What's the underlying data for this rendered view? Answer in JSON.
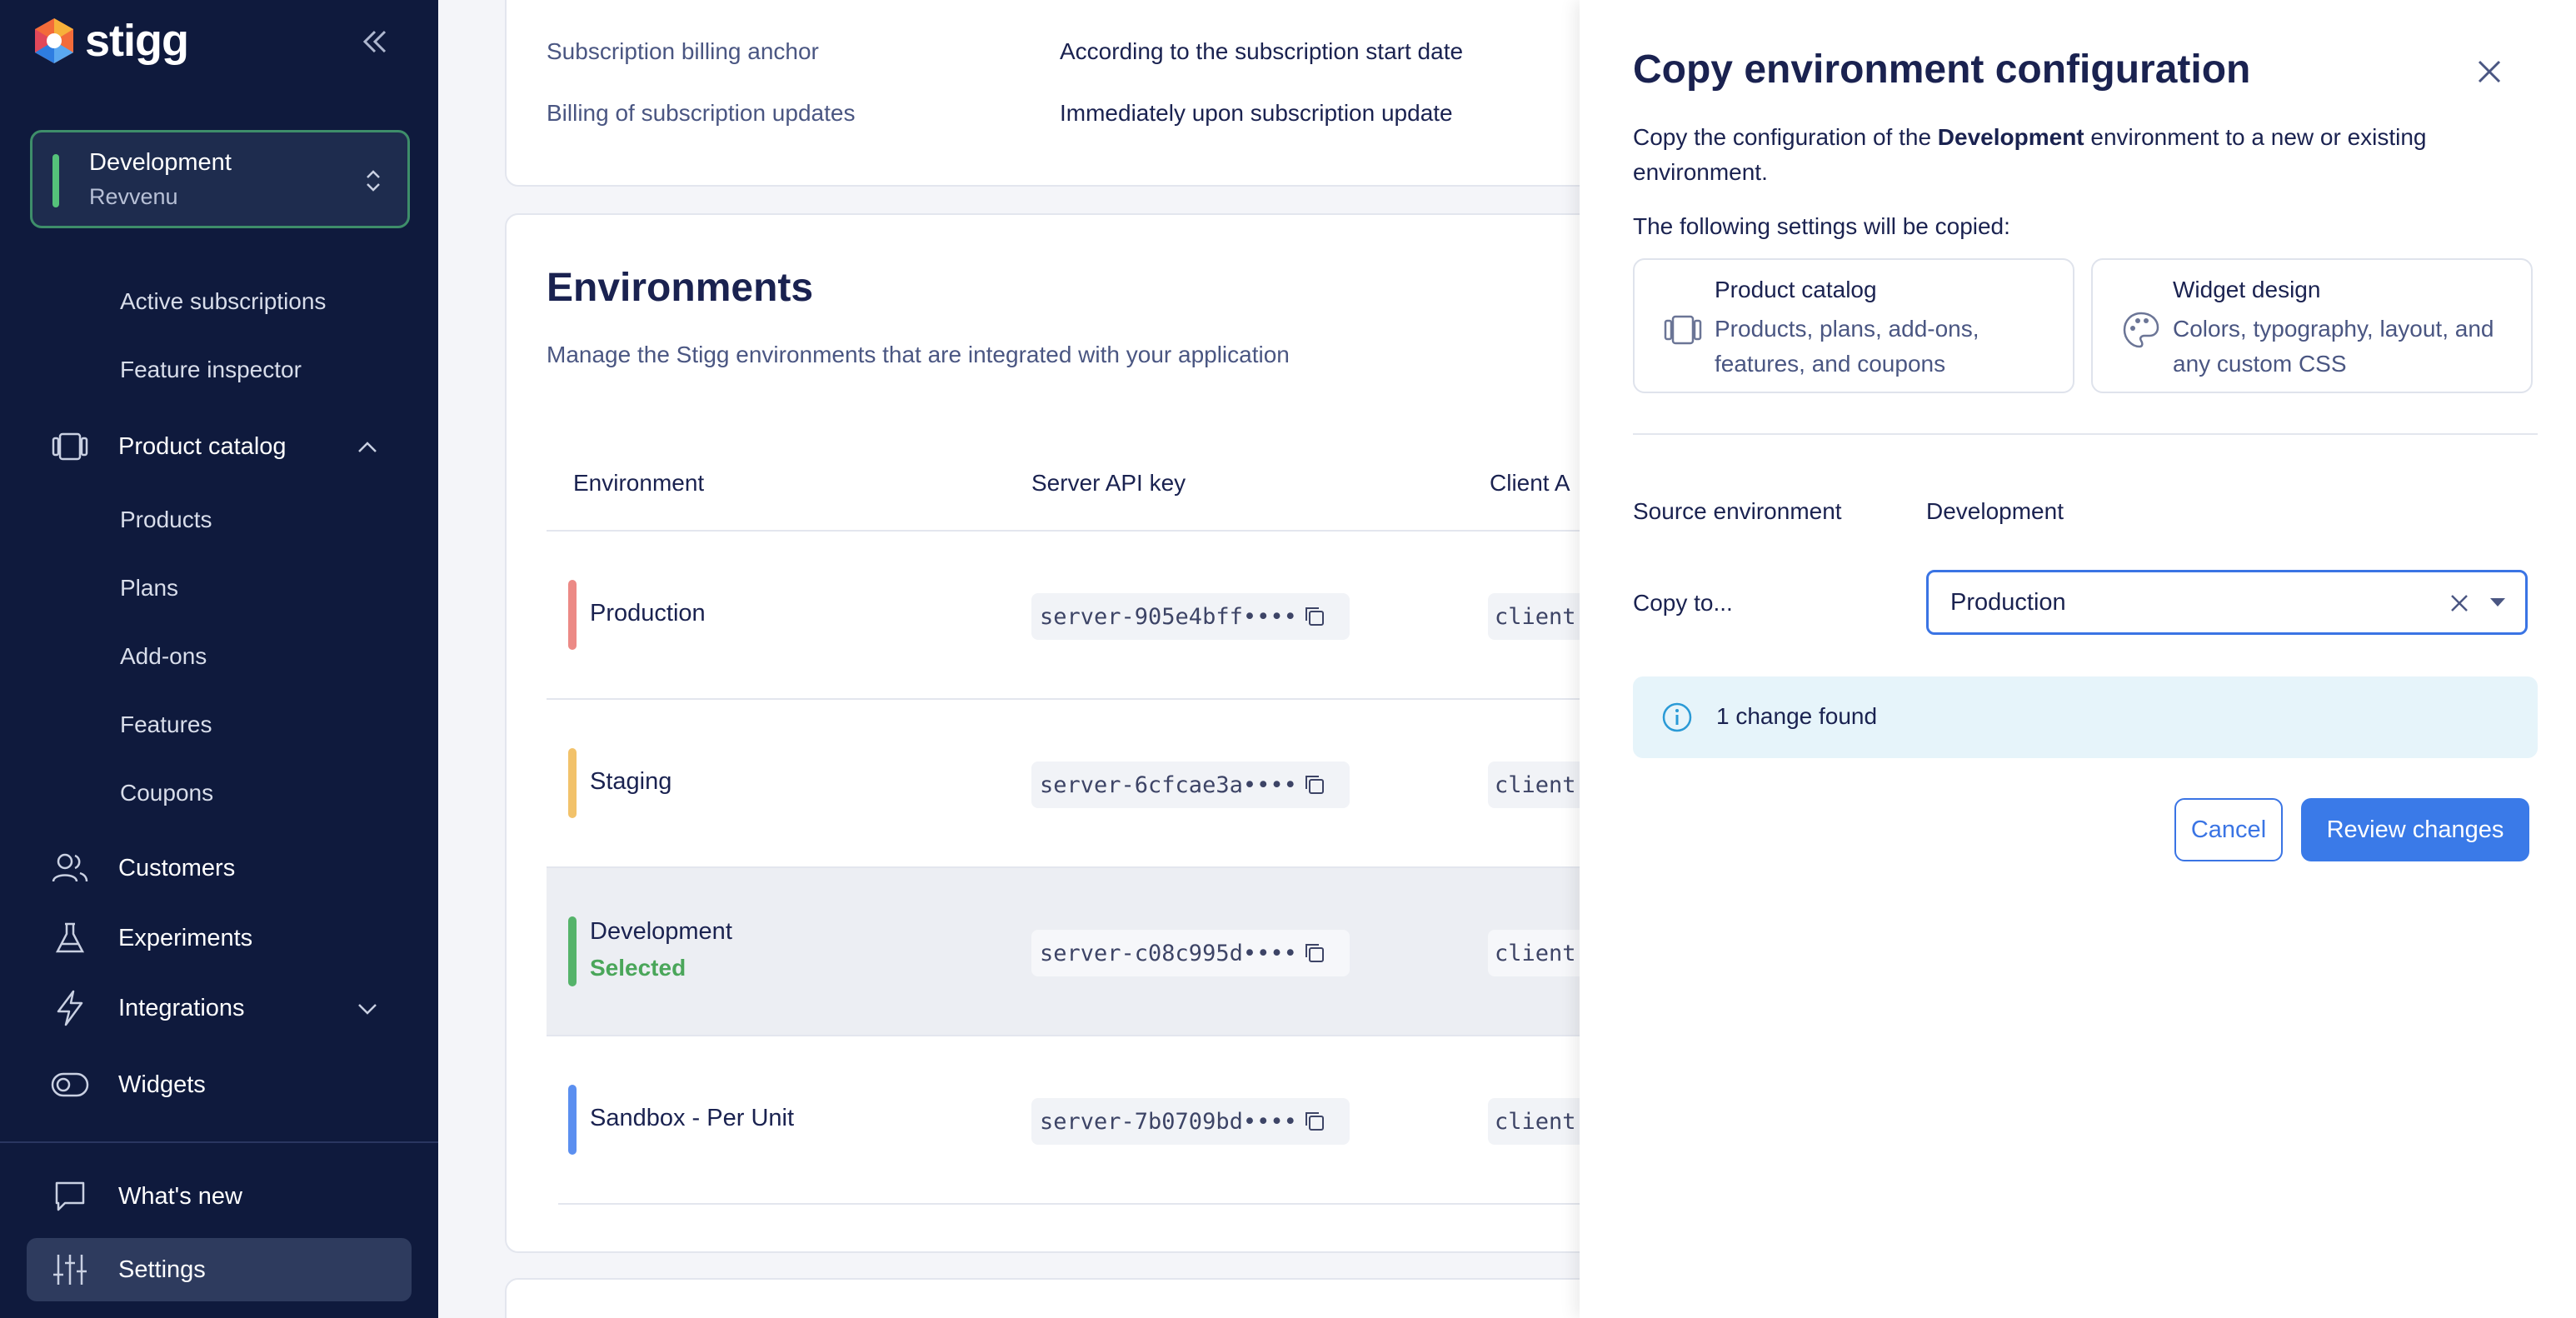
{
  "app": {
    "logo_text": "stigg"
  },
  "sidebar": {
    "environment": {
      "name": "Development",
      "sub": "Revvenu",
      "color": "#55c27a"
    },
    "sub_items_top": [
      {
        "label": "Active subscriptions"
      },
      {
        "label": "Feature inspector"
      }
    ],
    "product_catalog": {
      "label": "Product catalog",
      "items": [
        {
          "label": "Products"
        },
        {
          "label": "Plans"
        },
        {
          "label": "Add-ons"
        },
        {
          "label": "Features"
        },
        {
          "label": "Coupons"
        }
      ]
    },
    "customers_label": "Customers",
    "experiments_label": "Experiments",
    "integrations_label": "Integrations",
    "widgets_label": "Widgets",
    "whats_new_label": "What's new",
    "settings_label": "Settings"
  },
  "billing": {
    "anchor_label": "Subscription billing anchor",
    "anchor_value": "According to the subscription start date",
    "updates_label": "Billing of subscription updates",
    "updates_value": "Immediately upon subscription update"
  },
  "environments": {
    "title": "Environments",
    "description": "Manage the Stigg environments that are integrated with your application",
    "columns": [
      "Environment",
      "Server API key",
      "Client A"
    ],
    "selected_label": "Selected",
    "rows": [
      {
        "name": "Production",
        "server_key": "server-905e4bff••••",
        "client_key": "client",
        "color": "#ec8a86"
      },
      {
        "name": "Staging",
        "server_key": "server-6cfcae3a••••",
        "client_key": "client",
        "color": "#f2c26a"
      },
      {
        "name": "Development",
        "server_key": "server-c08c995d••••",
        "client_key": "client",
        "color": "#55b36a"
      },
      {
        "name": "Sandbox - Per Unit",
        "server_key": "server-7b0709bd••••",
        "client_key": "client",
        "color": "#5b8ff0"
      }
    ]
  },
  "drawer": {
    "title": "Copy environment configuration",
    "desc_prefix": "Copy the configuration of the ",
    "desc_env": "Development",
    "desc_suffix": " environment to a new or existing environment.",
    "following": "The following settings will be copied:",
    "options": [
      {
        "title": "Product catalog",
        "sub": "Products, plans, add-ons, features, and coupons",
        "icon": "product-catalog-icon"
      },
      {
        "title": "Widget design",
        "sub": "Colors, typography, layout, and any custom CSS",
        "icon": "palette-icon"
      }
    ],
    "source_label": "Source environment",
    "source_value": "Development",
    "copy_to_label": "Copy to...",
    "copy_to_value": "Production",
    "info_text": "1 change found",
    "cancel_label": "Cancel",
    "review_label": "Review changes"
  }
}
